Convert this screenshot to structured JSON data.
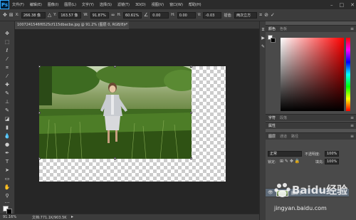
{
  "app": {
    "logo": "Ps",
    "menu": [
      "文件(F)",
      "编辑(E)",
      "图像(I)",
      "图层(L)",
      "文字(Y)",
      "选择(S)",
      "滤镜(T)",
      "3D(D)",
      "视图(V)",
      "窗口(W)",
      "帮助(H)"
    ],
    "window_controls": [
      "–",
      "□",
      "✕"
    ]
  },
  "options_bar": {
    "x_label": "X:",
    "x_value": "266.38 像",
    "y_label": "Y:",
    "y_value": "163.57 像",
    "w_label": "W:",
    "w_value": "91.87%",
    "h_label": "H:",
    "h_value": "60.61%",
    "angle_value": "0.00",
    "skew_h_label": "H:",
    "skew_h_value": "0.00",
    "skew_v_label": "V:",
    "skew_v_value": "-0.03",
    "interp_label": "插值:",
    "interp_value": "两次立方"
  },
  "document": {
    "tab_title": "1007241546f6525cf115dbacba.jpg @ 91.2% (图层 0, RGB/8) *",
    "tab_close": "×"
  },
  "status": {
    "zoom": "91.16%",
    "doc_info": "文档:771.1K/903.5K"
  },
  "panels": {
    "color_tabs": [
      "颜色",
      "色板"
    ],
    "char_tabs": [
      "字符",
      "段落"
    ],
    "props_tabs": [
      "属性"
    ],
    "layers_tabs": [
      "图层",
      "通道",
      "路径"
    ],
    "blend_mode": "正常",
    "opacity_label": "不透明度:",
    "opacity_value": "100%",
    "lock_label": "锁定:",
    "fill_label": "填充:",
    "fill_value": "100%",
    "layer_name": "图层 0"
  },
  "watermark": {
    "brand": "Baidu经验",
    "url": "jingyan.baidu.com"
  },
  "colors": {
    "foreground": "#ffffff",
    "background": "#000000",
    "hue": "#ff0000"
  }
}
